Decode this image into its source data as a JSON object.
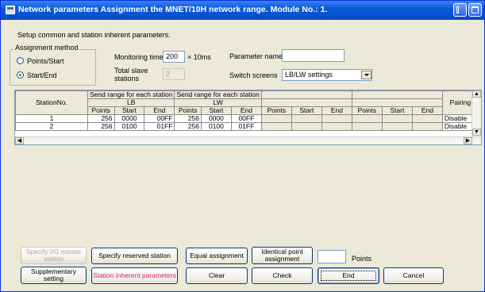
{
  "window": {
    "title": "Network parameters  Assignment the MNET/10H network range. Module No.: 1."
  },
  "intro_text": "Setup common and station inherent parameters.",
  "assignment_method": {
    "title": "Assignment method",
    "options": [
      "Points/Start",
      "Start/End"
    ],
    "selected": "Start/End"
  },
  "monitoring_time": {
    "label": "Monitoring time",
    "value": "200",
    "unit": "× 10ms"
  },
  "total_slave": {
    "label_line1": "Total slave",
    "label_line2": "stations",
    "value": "2"
  },
  "parameter_name": {
    "label": "Parameter name",
    "value": ""
  },
  "switch_screens": {
    "label": "Switch screens",
    "value": "LB/LW settings"
  },
  "grid": {
    "station_header": "StationNo.",
    "send_range_label": "Send range for each station",
    "lb_label": "LB",
    "lw_label": "LW",
    "col_points": "Points",
    "col_start": "Start",
    "col_end": "End",
    "pairing_header": "Pairing",
    "rows": [
      {
        "station": "1",
        "lb_points": "256",
        "lb_start": "0000",
        "lb_end": "00FF",
        "lw_points": "256",
        "lw_start": "0000",
        "lw_end": "00FF",
        "pairing": "Disable"
      },
      {
        "station": "2",
        "lb_points": "256",
        "lb_start": "0100",
        "lb_end": "01FF",
        "lw_points": "256",
        "lw_start": "0100",
        "lw_end": "01FF",
        "pairing": "Disable"
      }
    ]
  },
  "buttons": {
    "specify_io_master_line1": "Specify I/O master",
    "specify_io_master_line2": "station",
    "specify_reserved": "Specify reserved station",
    "equal_assignment": "Equal assignment",
    "identical_point_line1": "Identical point",
    "identical_point_line2": "assignment",
    "points_label": "Points",
    "points_value": "",
    "supplementary_line1": "Supplementary",
    "supplementary_line2": "setting",
    "station_inherent": "Station inherent parameters",
    "clear": "Clear",
    "check": "Check",
    "end": "End",
    "cancel": "Cancel"
  },
  "colors": {
    "station_inherent_text": "#e0207a",
    "titlebar": "#0a5bd8"
  }
}
